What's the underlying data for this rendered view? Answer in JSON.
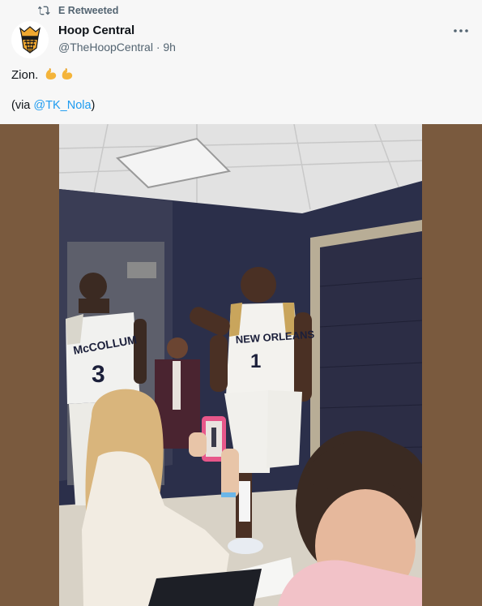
{
  "retweet": {
    "label": "E Retweeted",
    "icon": "retweet-icon"
  },
  "author": {
    "name": "Hoop Central",
    "handle": "@TheHoopCentral",
    "separator": "·",
    "time": "9h",
    "avatar_icon": "hoop-central-logo"
  },
  "menu": {
    "icon": "more-dots-icon"
  },
  "tweet": {
    "text": "Zion.",
    "emoji": [
      "flexed-biceps-emoji",
      "flexed-biceps-emoji"
    ],
    "via_prefix": "(via ",
    "via_handle": "@TK_Nola",
    "via_suffix": ")"
  },
  "media": {
    "description_icon": "photo",
    "jersey_left_name": "McCOLLUM",
    "jersey_left_number": "3",
    "jersey_center_text": "NEW ORLEANS",
    "jersey_center_number": "1"
  },
  "colors": {
    "background": "#f7f7f7",
    "link": "#1d9bf0",
    "secondary_text": "#536471",
    "media_letterbox": "#7a5a3e"
  }
}
